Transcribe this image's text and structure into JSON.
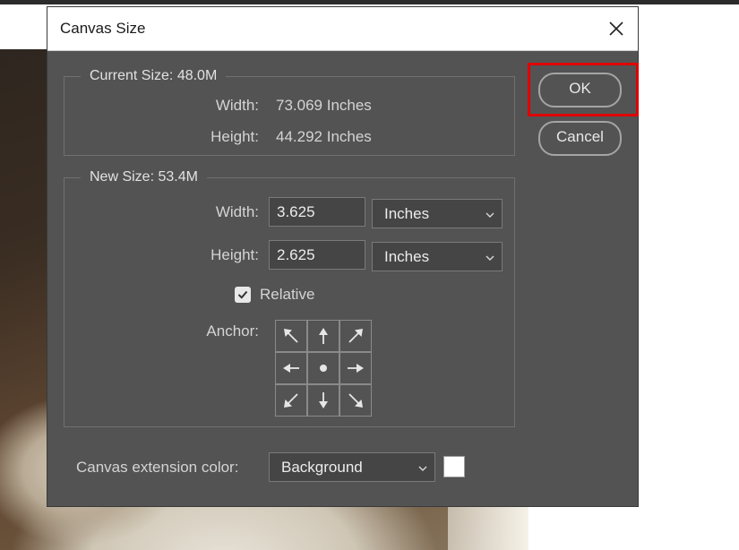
{
  "dialog": {
    "title": "Canvas Size",
    "close_icon": "close-icon"
  },
  "current_size": {
    "legend": "Current Size: 48.0M",
    "width_label": "Width:",
    "width_value": "73.069 Inches",
    "height_label": "Height:",
    "height_value": "44.292 Inches"
  },
  "new_size": {
    "legend": "New Size: 53.4M",
    "width_label": "Width:",
    "width_value": "3.625",
    "width_unit": "Inches",
    "height_label": "Height:",
    "height_value": "2.625",
    "height_unit": "Inches",
    "relative_label": "Relative",
    "relative_checked": true,
    "anchor_label": "Anchor:"
  },
  "extension": {
    "label": "Canvas extension color:",
    "value": "Background",
    "swatch_color": "#ffffff"
  },
  "buttons": {
    "ok": "OK",
    "cancel": "Cancel"
  },
  "colors": {
    "dialog_bg": "#535353",
    "highlight": "#e00000"
  }
}
